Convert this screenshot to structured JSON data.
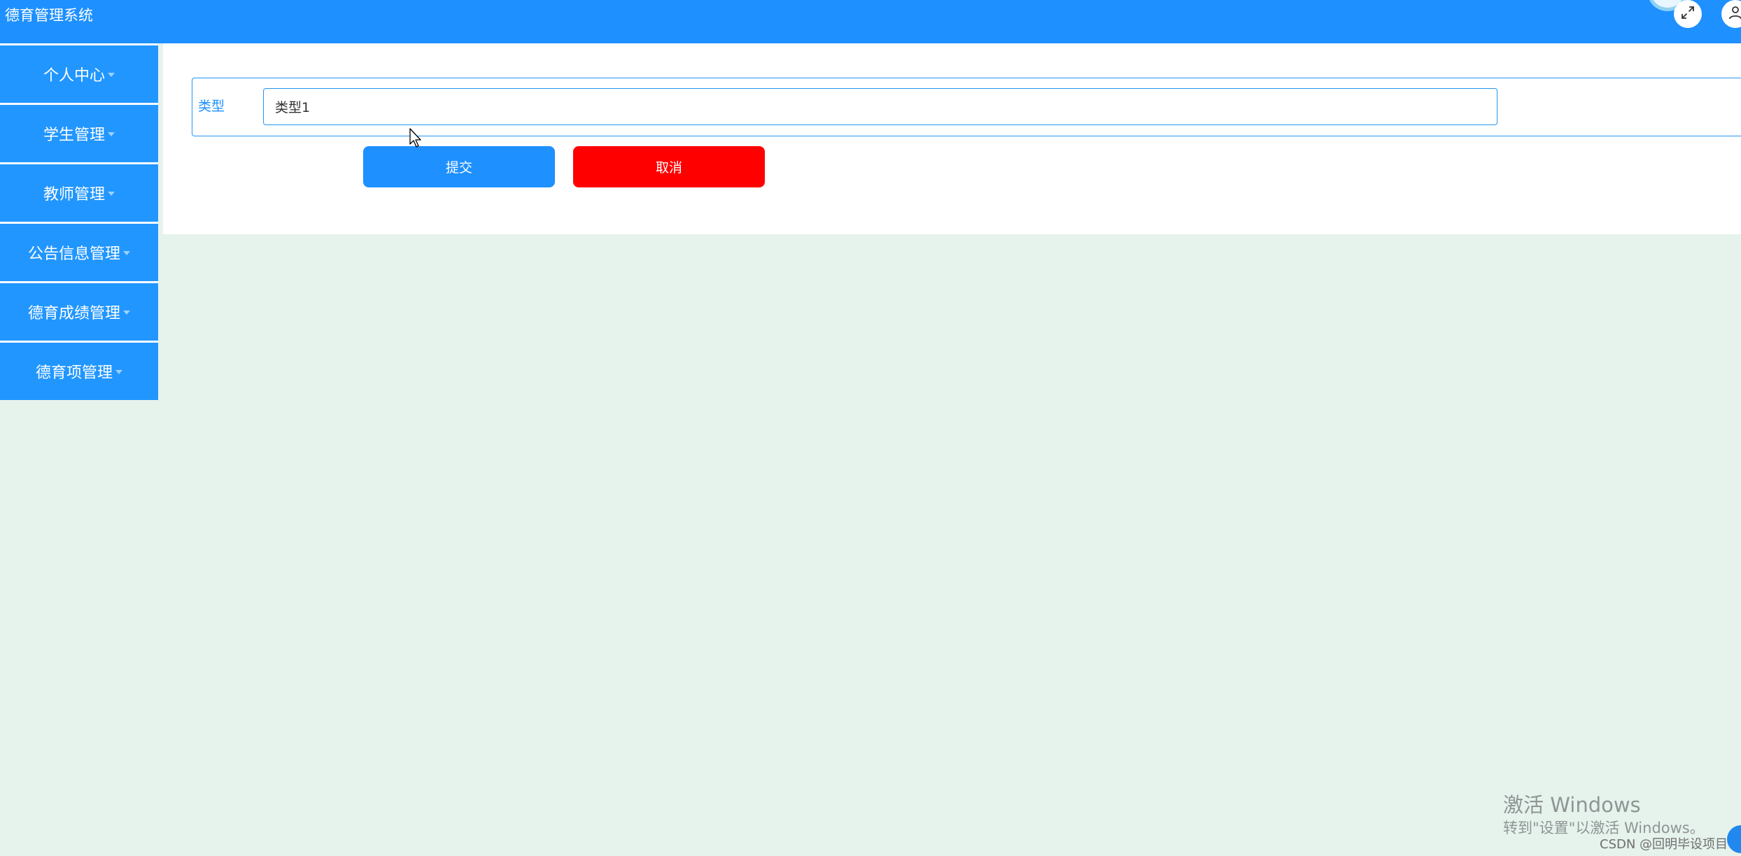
{
  "app": {
    "title": "德育管理系统"
  },
  "header": {
    "icons": [
      "fullscreen-icon",
      "user-icon"
    ]
  },
  "sidebar": {
    "items": [
      {
        "label": "个人中心"
      },
      {
        "label": "学生管理"
      },
      {
        "label": "教师管理"
      },
      {
        "label": "公告信息管理"
      },
      {
        "label": "德育成绩管理"
      },
      {
        "label": "德育项管理"
      }
    ]
  },
  "form": {
    "type_label": "类型",
    "type_value": "类型1",
    "submit_label": "提交",
    "cancel_label": "取消"
  },
  "overlay": {
    "activation_title": "激活 Windows",
    "activation_hint": "转到\"设置\"以激活 Windows。",
    "credit": "CSDN @回明毕设项目"
  },
  "colors": {
    "primary": "#1e90ff",
    "danger": "#ff0000",
    "page_background": "#e6f2ec"
  }
}
